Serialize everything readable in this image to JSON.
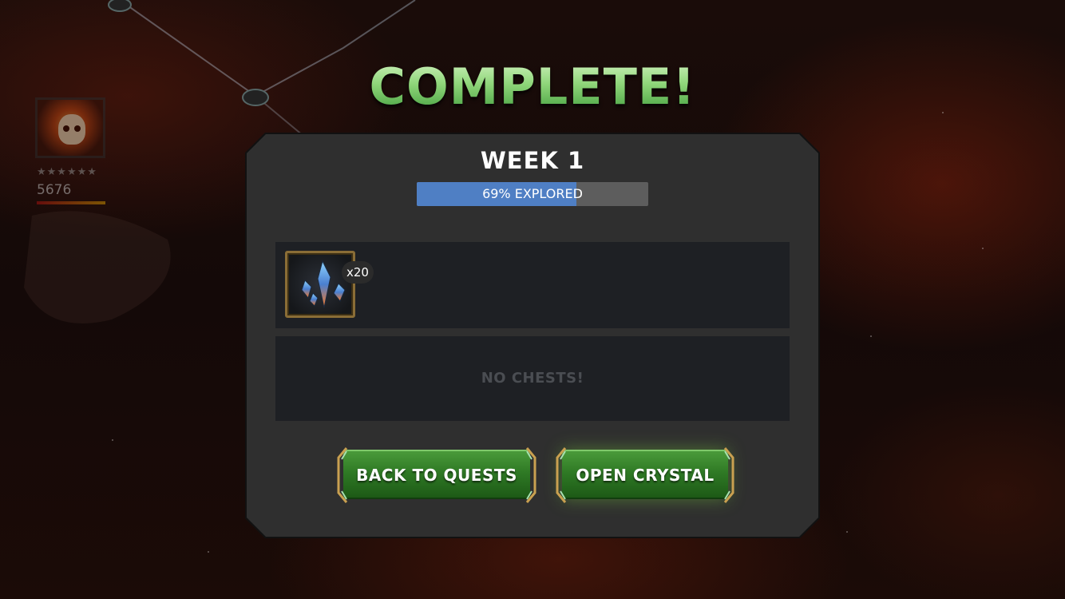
{
  "screen": {
    "title": "COMPLETE!"
  },
  "background": {
    "champion": {
      "rating": "5676",
      "stars": "★★★★★★"
    }
  },
  "panel": {
    "week_title": "WEEK 1",
    "progress": {
      "fraction": 0.69,
      "label": "69% EXPLORED"
    },
    "rewards": [
      {
        "icon": "crystal-shards-icon",
        "quantity": "x20"
      }
    ],
    "chests": {
      "empty_text": "NO CHESTS!"
    },
    "buttons": {
      "back": "BACK TO QUESTS",
      "open": "OPEN CRYSTAL"
    }
  },
  "colors": {
    "title_green": "#8fd67a",
    "progress_fill": "#4f7fc4",
    "button_green": "#2f7a25",
    "reward_frame": "#8a6d36"
  }
}
